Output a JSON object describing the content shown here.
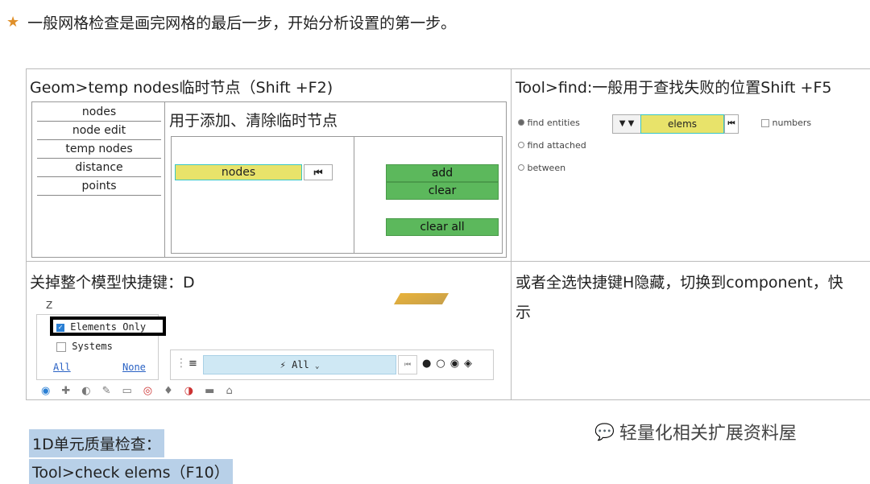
{
  "intro": {
    "text": "一般网格检查是画完网格的最后一步，开始分析设置的第一步。"
  },
  "cell_geom": {
    "title": "Geom>temp nodes临时节点（Shift +F2)",
    "menu_items": [
      "nodes",
      "node edit",
      "temp nodes",
      "distance",
      "points"
    ],
    "description": "用于添加、清除临时节点",
    "field_label": "nodes",
    "buttons": [
      "add",
      "clear",
      "clear all"
    ]
  },
  "cell_find": {
    "title": "Tool>find:一般用于查找失败的位置Shift +F5",
    "radios": [
      "find entities",
      "find attached",
      "between"
    ],
    "field_label": "elems",
    "checkbox_label": "numbers"
  },
  "cell_d": {
    "title": "关掉整个模型快捷键：D",
    "axis_label": "Z",
    "filter_items": [
      "Elements Only",
      "Systems"
    ],
    "links": [
      "All",
      "None"
    ],
    "selector_label": "All"
  },
  "cell_h": {
    "title": "或者全选快捷键H隐藏，切换到component，快",
    "line2": "示"
  },
  "section": {
    "heading": "1D单元质量检查：",
    "next_line": "Tool>check elems（F10）"
  },
  "watermark": {
    "text": "轻量化相关扩展资料屋"
  }
}
